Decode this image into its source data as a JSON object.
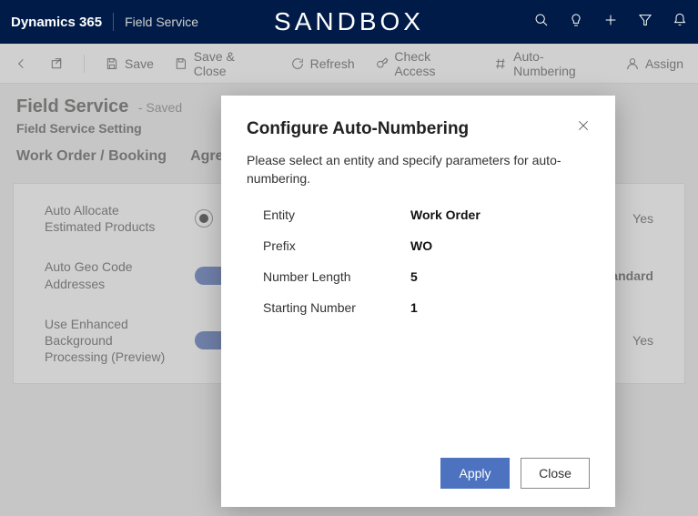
{
  "topbar": {
    "brand": "Dynamics 365",
    "app": "Field Service",
    "env": "SANDBOX"
  },
  "cmdbar": {
    "save": "Save",
    "save_close": "Save & Close",
    "refresh": "Refresh",
    "check_access": "Check Access",
    "auto_numbering": "Auto-Numbering",
    "assign": "Assign"
  },
  "page": {
    "title": "Field Service",
    "saved": "- Saved",
    "subtitle": "Field Service Setting",
    "tabs": [
      "Work Order / Booking",
      "Agre"
    ]
  },
  "form": {
    "fields": [
      {
        "label": "Auto Allocate Estimated Products",
        "control": "radio",
        "right": "Yes"
      },
      {
        "label": "Auto Geo Code Addresses",
        "control": "toggle",
        "right": "/Standard"
      },
      {
        "label": "Use Enhanced Background Processing (Preview)",
        "control": "toggle",
        "right": "Yes"
      }
    ]
  },
  "dialog": {
    "title": "Configure Auto-Numbering",
    "desc": "Please select an entity and specify parameters for auto-numbering.",
    "rows": [
      {
        "k": "Entity",
        "v": "Work Order"
      },
      {
        "k": "Prefix",
        "v": "WO"
      },
      {
        "k": "Number Length",
        "v": "5"
      },
      {
        "k": "Starting Number",
        "v": "1"
      }
    ],
    "apply": "Apply",
    "close": "Close"
  }
}
